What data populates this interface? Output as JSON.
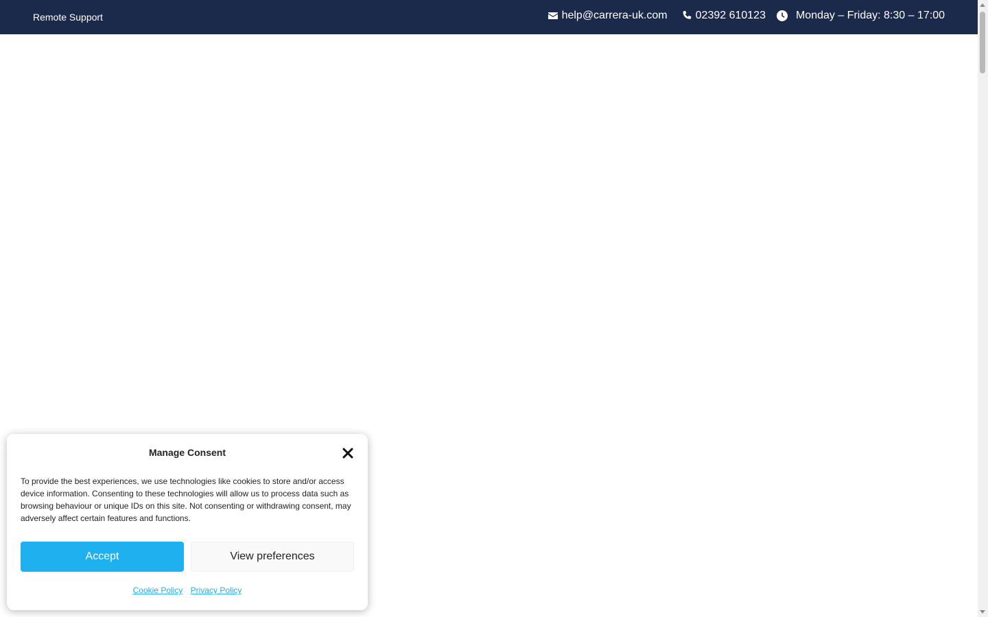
{
  "colors": {
    "bar_background": "#1b2a4a",
    "accent": "#1eb0ef",
    "link": "#1eb0ef"
  },
  "topbar": {
    "remote_support": "Remote Support",
    "email": "help@carrera-uk.com",
    "phone": "02392 610123",
    "hours": "Monday – Friday: 8:30 – 17:00",
    "icons": [
      "envelope-icon",
      "phone-icon",
      "clock-icon"
    ]
  },
  "consent": {
    "title": "Manage Consent",
    "body": "To provide the best experiences, we use technologies like cookies to store and/or access device information. Consenting to these technologies will allow us to process data such as browsing behaviour or unique IDs on this site. Not consenting or withdrawing consent, may adversely affect certain features and functions.",
    "accept_label": "Accept",
    "preferences_label": "View preferences",
    "cookie_policy": "Cookie Policy",
    "privacy_policy": "Privacy Policy",
    "close_icon": "close-icon"
  }
}
